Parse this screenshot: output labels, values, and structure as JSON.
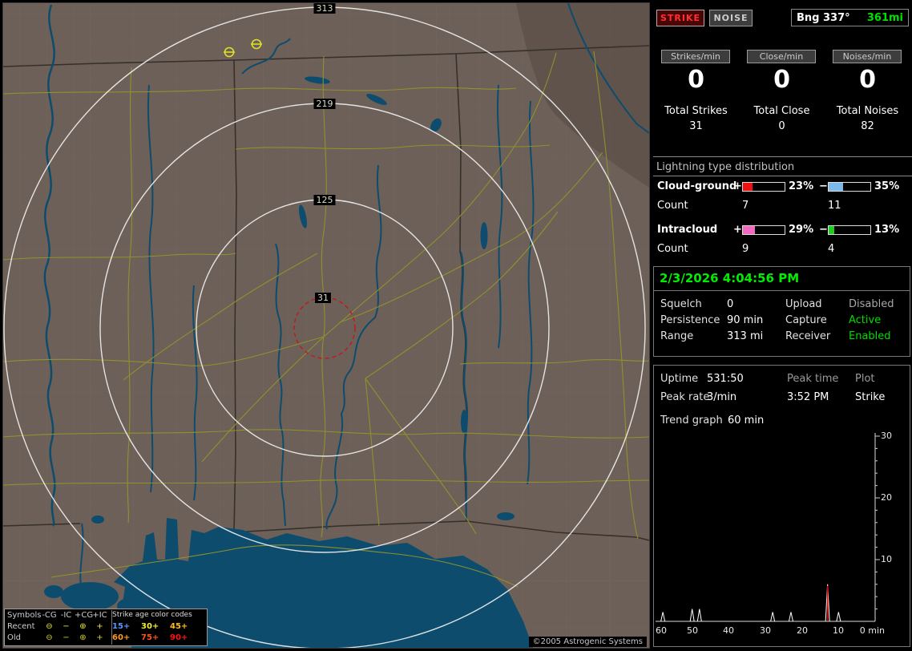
{
  "header": {
    "strike_button": "STRIKE",
    "noise_button": "NOISE",
    "bearing_label": "Bng 337°",
    "bearing_range": "361mi"
  },
  "rates": {
    "columns": [
      {
        "button": "Strikes/min",
        "value": "0",
        "total_label": "Total Strikes",
        "total": "31"
      },
      {
        "button": "Close/min",
        "value": "0",
        "total_label": "Total Close",
        "total": "0"
      },
      {
        "button": "Noises/min",
        "value": "0",
        "total_label": "Total Noises",
        "total": "82"
      }
    ]
  },
  "distribution": {
    "title": "Lightning type distribution",
    "rows": [
      {
        "name": "Cloud-ground",
        "plus_sign": "+",
        "minus_sign": "−",
        "plus": {
          "pct": 23,
          "color": "#ee1111"
        },
        "plus_pct_label": "23%",
        "minus": {
          "pct": 35,
          "color": "#7cb9e8"
        },
        "minus_pct_label": "35%",
        "count_label": "Count",
        "plus_count": "7",
        "minus_count": "11"
      },
      {
        "name": "Intracloud",
        "plus_sign": "+",
        "minus_sign": "−",
        "plus": {
          "pct": 29,
          "color": "#f06ac0"
        },
        "plus_pct_label": "29%",
        "minus": {
          "pct": 13,
          "color": "#22cc22"
        },
        "minus_pct_label": "13%",
        "count_label": "Count",
        "plus_count": "9",
        "minus_count": "4"
      }
    ]
  },
  "status": {
    "datetime": "2/3/2026 4:04:56 PM",
    "left": [
      {
        "label": "Squelch",
        "value": "0"
      },
      {
        "label": "Persistence",
        "value": "90 min"
      },
      {
        "label": "Range",
        "value": "313 mi"
      }
    ],
    "right": [
      {
        "label": "Upload",
        "value": "Disabled",
        "color": "#a8a8a8"
      },
      {
        "label": "Capture",
        "value": "Active",
        "color": "#00dd00"
      },
      {
        "label": "Receiver",
        "value": "Enabled",
        "color": "#00dd00"
      }
    ]
  },
  "stats": {
    "uptime_label": "Uptime",
    "uptime": "531:50",
    "peak_rate_label": "Peak rate",
    "peak_rate": "3/min",
    "peak_time_label": "Peak time",
    "peak_time": "3:52 PM",
    "plot_label": "Plot",
    "plot": "Strike",
    "trend_label": "Trend graph",
    "trend_window": "60 min"
  },
  "trend_chart": {
    "type": "line",
    "x_labels": [
      "60",
      "50",
      "40",
      "30",
      "20",
      "10",
      "0 min"
    ],
    "x_minutes": [
      60,
      50,
      40,
      30,
      20,
      10,
      0
    ],
    "y_tick_labels": [
      "10",
      "20",
      "30"
    ],
    "ylim": [
      0,
      30
    ],
    "spikes": [
      {
        "min": 58,
        "h": 1.5
      },
      {
        "min": 50,
        "h": 2
      },
      {
        "min": 48,
        "h": 2
      },
      {
        "min": 28,
        "h": 1.5
      },
      {
        "min": 23,
        "h": 1.5
      },
      {
        "min": 13,
        "h": 6,
        "red": true
      },
      {
        "min": 10,
        "h": 1.5
      }
    ]
  },
  "map": {
    "rings": [
      {
        "label": "313"
      },
      {
        "label": "219"
      },
      {
        "label": "125"
      },
      {
        "label": "31"
      }
    ],
    "copyright": "©2005 Astrogenic Systems",
    "legend": {
      "symbols_header": "Symbols",
      "col_headers": [
        "-CG",
        "-IC",
        "+CG",
        "+IC"
      ],
      "age_title": "Strike age color codes",
      "rows": [
        {
          "label": "Recent",
          "symbol_color": "#e8e833",
          "symbols": [
            "⊖",
            "−",
            "⊕",
            "+"
          ],
          "ages": [
            {
              "text": "15+",
              "color": "#5599ff"
            },
            {
              "text": "30+",
              "color": "#eeee33"
            },
            {
              "text": "45+",
              "color": "#ffbb22"
            }
          ]
        },
        {
          "label": "Old",
          "symbol_color": "#cfcf28",
          "symbols": [
            "⊖",
            "−",
            "⊕",
            "+"
          ],
          "ages": [
            {
              "text": "60+",
              "color": "#ff9922"
            },
            {
              "text": "75+",
              "color": "#ff5511"
            },
            {
              "text": "90+",
              "color": "#ff1111"
            }
          ]
        }
      ]
    }
  }
}
